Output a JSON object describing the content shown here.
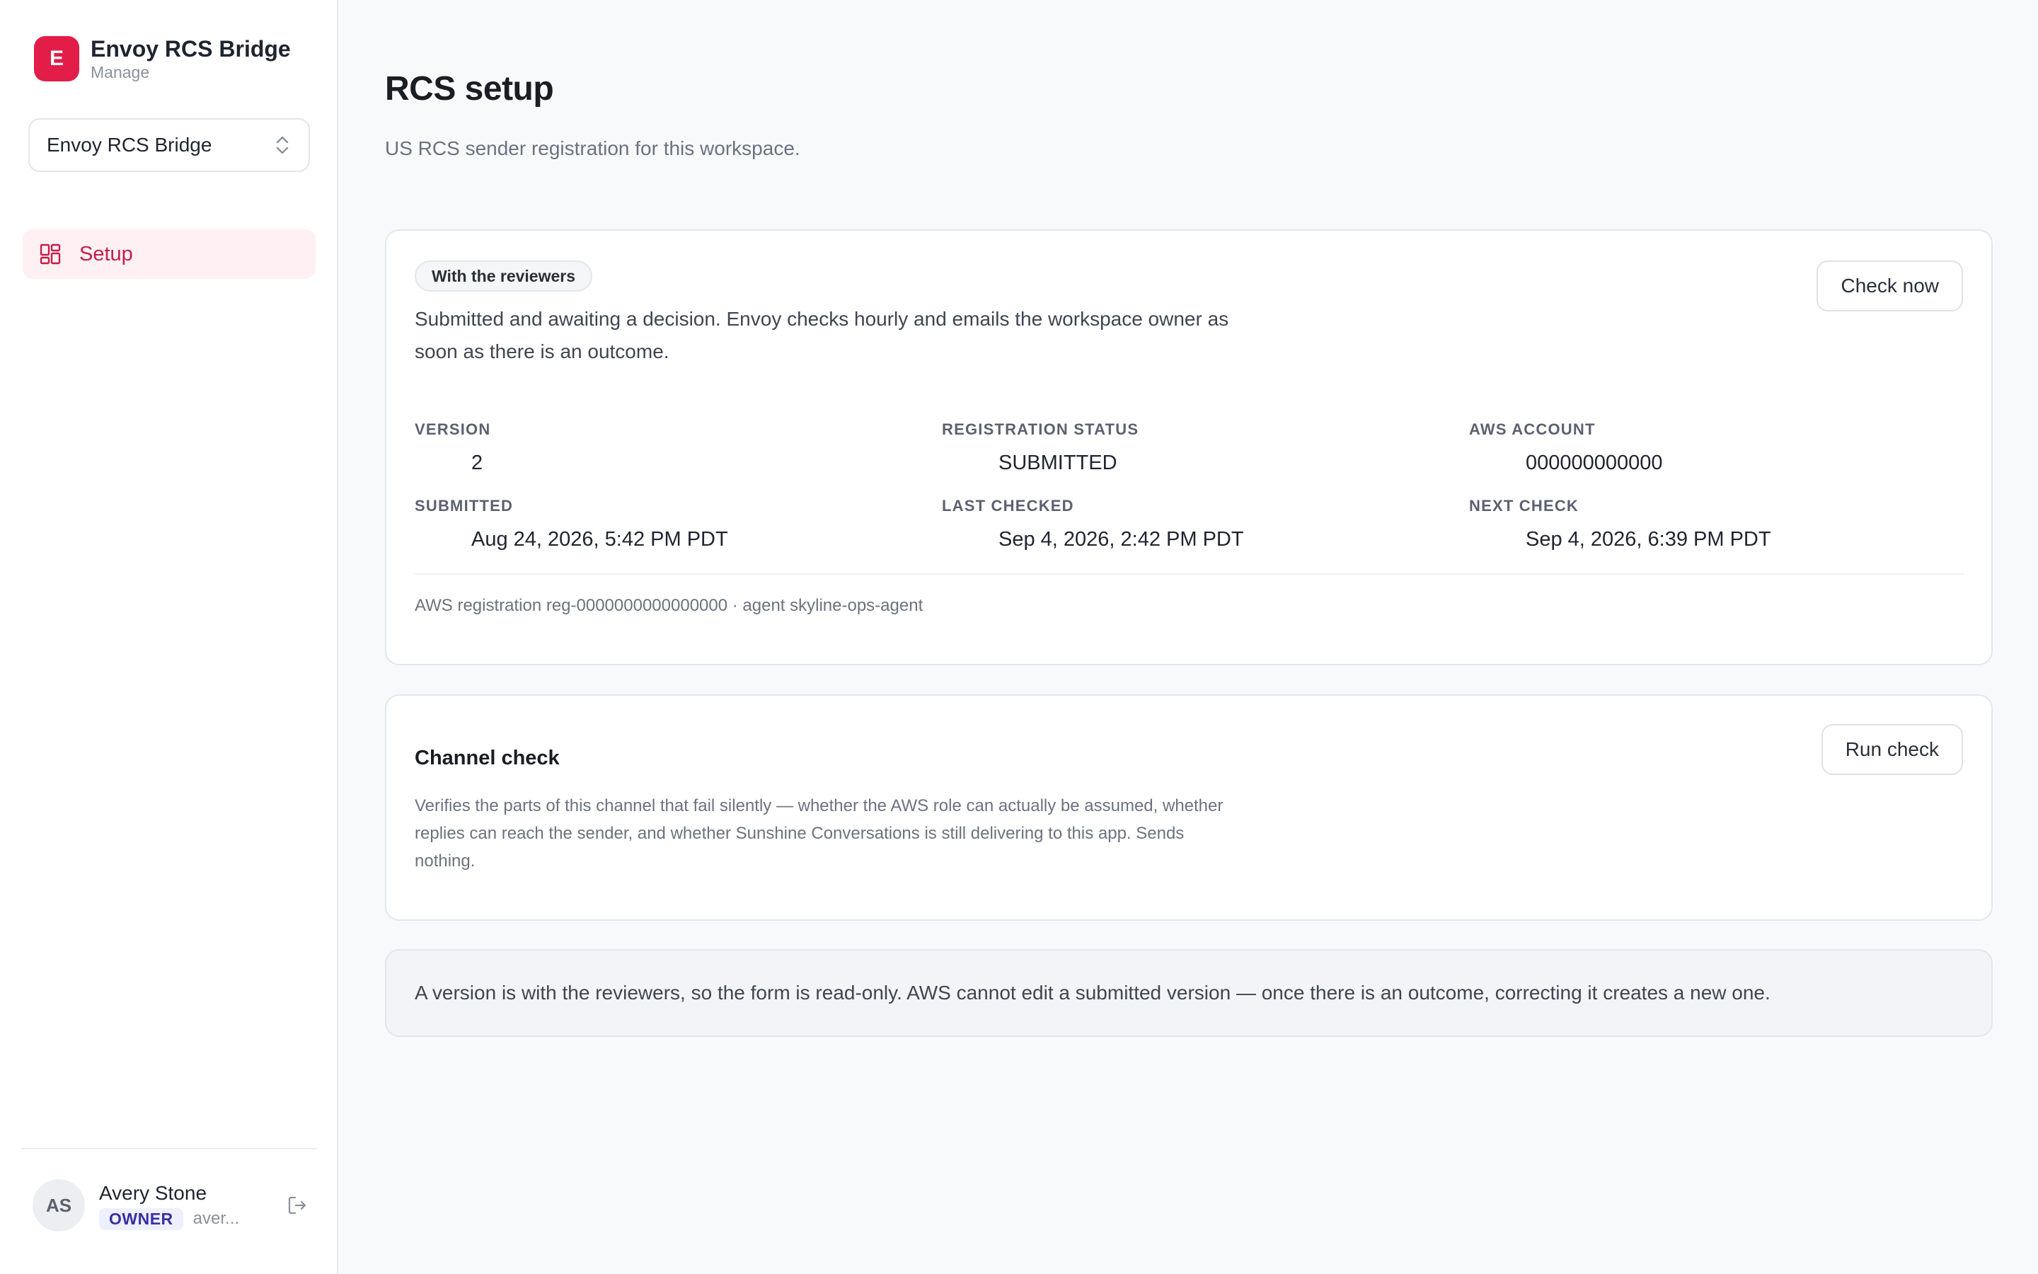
{
  "sidebar": {
    "brand": {
      "logo_letter": "E",
      "name": "Envoy RCS Bridge",
      "subtitle": "Manage"
    },
    "workspace_select": {
      "value": "Envoy RCS Bridge"
    },
    "nav": [
      {
        "label": "Setup",
        "icon": "grid-icon",
        "active": true
      }
    ],
    "user": {
      "initials": "AS",
      "name": "Avery Stone",
      "role": "OWNER",
      "email_truncated": "aver..."
    }
  },
  "page": {
    "title": "RCS setup",
    "subtitle": "US RCS sender registration for this workspace."
  },
  "status_card": {
    "pill": "With the reviewers",
    "description": "Submitted and awaiting a decision. Envoy checks hourly and emails the workspace owner as soon as there is an outcome.",
    "action_label": "Check now",
    "fields": {
      "version": {
        "label": "VERSION",
        "value": "2"
      },
      "registration_status": {
        "label": "REGISTRATION STATUS",
        "value": "SUBMITTED"
      },
      "aws_account": {
        "label": "AWS ACCOUNT",
        "value": "000000000000"
      },
      "submitted": {
        "label": "SUBMITTED",
        "value": "Aug 24, 2026, 5:42 PM PDT"
      },
      "last_checked": {
        "label": "LAST CHECKED",
        "value": "Sep 4, 2026, 2:42 PM PDT"
      },
      "next_check": {
        "label": "NEXT CHECK",
        "value": "Sep 4, 2026, 6:39 PM PDT"
      }
    },
    "footer": "AWS registration reg-0000000000000000 · agent skyline-ops-agent"
  },
  "channel_check": {
    "title": "Channel check",
    "description": "Verifies the parts of this channel that fail silently — whether the AWS role can actually be assumed, whether replies can reach the sender, and whether Sunshine Conversations is still delivering to this app. Sends nothing.",
    "action_label": "Run check"
  },
  "notice": {
    "text": "A version is with the reviewers, so the form is read-only. AWS cannot edit a submitted version — once there is an outcome, correcting it creates a new one."
  },
  "colors": {
    "accent": "#e11d48",
    "nav_active_bg": "#fff1f3",
    "nav_active_text": "#c51d4a",
    "role_badge_bg": "#eef0ff",
    "role_badge_text": "#3730a3"
  }
}
